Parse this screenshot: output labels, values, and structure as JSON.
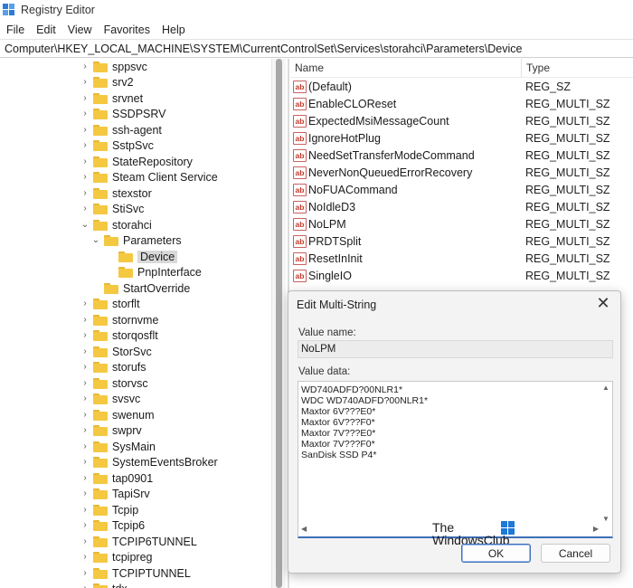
{
  "window": {
    "title": "Registry Editor"
  },
  "menu": [
    "File",
    "Edit",
    "View",
    "Favorites",
    "Help"
  ],
  "address": "Computer\\HKEY_LOCAL_MACHINE\\SYSTEM\\CurrentControlSet\\Services\\storahci\\Parameters\\Device",
  "tree": [
    {
      "label": "sppsvc",
      "expand": "›"
    },
    {
      "label": "srv2",
      "expand": "›"
    },
    {
      "label": "srvnet",
      "expand": "›"
    },
    {
      "label": "SSDPSRV",
      "expand": "›"
    },
    {
      "label": "ssh-agent",
      "expand": "›"
    },
    {
      "label": "SstpSvc",
      "expand": "›"
    },
    {
      "label": "StateRepository",
      "expand": "›"
    },
    {
      "label": "Steam Client Service",
      "expand": "›"
    },
    {
      "label": "stexstor",
      "expand": "›"
    },
    {
      "label": "StiSvc",
      "expand": "›"
    },
    {
      "label": "storahci",
      "expand": "⌄"
    },
    {
      "label": "Parameters",
      "expand": "⌄"
    },
    {
      "label": "Device",
      "expand": ""
    },
    {
      "label": "PnpInterface",
      "expand": ""
    },
    {
      "label": "StartOverride",
      "expand": ""
    },
    {
      "label": "storflt",
      "expand": "›"
    },
    {
      "label": "stornvme",
      "expand": "›"
    },
    {
      "label": "storqosflt",
      "expand": "›"
    },
    {
      "label": "StorSvc",
      "expand": "›"
    },
    {
      "label": "storufs",
      "expand": "›"
    },
    {
      "label": "storvsc",
      "expand": "›"
    },
    {
      "label": "svsvc",
      "expand": "›"
    },
    {
      "label": "swenum",
      "expand": "›"
    },
    {
      "label": "swprv",
      "expand": "›"
    },
    {
      "label": "SysMain",
      "expand": "›"
    },
    {
      "label": "SystemEventsBroker",
      "expand": "›"
    },
    {
      "label": "tap0901",
      "expand": "›"
    },
    {
      "label": "TapiSrv",
      "expand": "›"
    },
    {
      "label": "Tcpip",
      "expand": "›"
    },
    {
      "label": "Tcpip6",
      "expand": "›"
    },
    {
      "label": "TCPIP6TUNNEL",
      "expand": "›"
    },
    {
      "label": "tcpipreg",
      "expand": "›"
    },
    {
      "label": "TCPIPTUNNEL",
      "expand": "›"
    },
    {
      "label": "tdx",
      "expand": "›"
    }
  ],
  "list": {
    "headers": {
      "name": "Name",
      "type": "Type"
    },
    "icon_text": "ab",
    "rows": [
      {
        "name": "(Default)",
        "type": "REG_SZ"
      },
      {
        "name": "EnableCLOReset",
        "type": "REG_MULTI_SZ"
      },
      {
        "name": "ExpectedMsiMessageCount",
        "type": "REG_MULTI_SZ"
      },
      {
        "name": "IgnoreHotPlug",
        "type": "REG_MULTI_SZ"
      },
      {
        "name": "NeedSetTransferModeCommand",
        "type": "REG_MULTI_SZ"
      },
      {
        "name": "NeverNonQueuedErrorRecovery",
        "type": "REG_MULTI_SZ"
      },
      {
        "name": "NoFUACommand",
        "type": "REG_MULTI_SZ"
      },
      {
        "name": "NoIdleD3",
        "type": "REG_MULTI_SZ"
      },
      {
        "name": "NoLPM",
        "type": "REG_MULTI_SZ"
      },
      {
        "name": "PRDTSplit",
        "type": "REG_MULTI_SZ"
      },
      {
        "name": "ResetInInit",
        "type": "REG_MULTI_SZ"
      },
      {
        "name": "SingleIO",
        "type": "REG_MULTI_SZ"
      }
    ]
  },
  "dialog": {
    "title": "Edit Multi-String",
    "close": "✕",
    "value_name_label": "Value name:",
    "value_name": "NoLPM",
    "value_data_label": "Value data:",
    "value_data": [
      "WD740ADFD?00NLR1*",
      "WDC WD740ADFD?00NLR1*",
      "Maxtor 6V???E0*",
      "Maxtor 6V???F0*",
      "Maxtor 7V???E0*",
      "Maxtor 7V???F0*",
      "SanDisk SSD P4*"
    ],
    "ok": "OK",
    "cancel": "Cancel"
  },
  "watermark": {
    "line1": "The",
    "line2": "WindowsClub"
  }
}
